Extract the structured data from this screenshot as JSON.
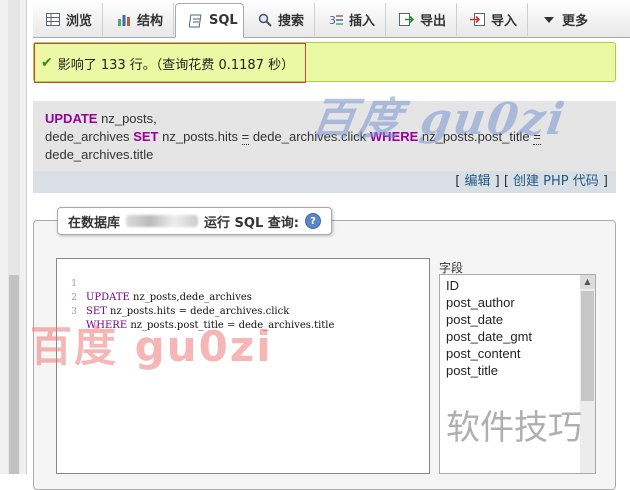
{
  "tabs": [
    {
      "label": "浏览",
      "icon": "browse-icon"
    },
    {
      "label": "结构",
      "icon": "structure-icon"
    },
    {
      "label": "SQL",
      "icon": "sql-icon"
    },
    {
      "label": "搜索",
      "icon": "search-icon"
    },
    {
      "label": "插入",
      "icon": "insert-icon"
    },
    {
      "label": "导出",
      "icon": "export-icon"
    },
    {
      "label": "导入",
      "icon": "import-icon"
    },
    {
      "label": "更多",
      "icon": "chevron-down-icon"
    }
  ],
  "message": {
    "text": "影响了 133 行。（查询花费 0.1187 秒）"
  },
  "sql_display": {
    "kw_update": "UPDATE",
    "t1": "nz_posts,",
    "t2": "dede_archives",
    "kw_set": "SET",
    "t3": "nz_posts.hits",
    "eq": "=",
    "t4": "dede_archives.click",
    "kw_where": "WHERE",
    "t5": "nz_posts.post_title",
    "t6": "dede_archives.title"
  },
  "sql_links": {
    "open": "[",
    "edit": "编辑",
    "mid": "] [",
    "create_php": "创建 PHP 代码",
    "close": "]"
  },
  "run_sql": {
    "legend_prefix": "在数据库",
    "legend_suffix": "运行 SQL 查询:"
  },
  "editor": {
    "lines": [
      {
        "num": "1",
        "kw": "UPDATE",
        "rest": " nz_posts,dede_archives"
      },
      {
        "num": "2",
        "kw": "SET",
        "rest": " nz_posts.hits = dede_archives.click"
      },
      {
        "num": "3",
        "kw": "WHERE",
        "rest": " nz_posts.post_title = dede_archives.title"
      }
    ]
  },
  "fields": {
    "label": "字段",
    "items": [
      "ID",
      "post_author",
      "post_date",
      "post_date_gmt",
      "post_content",
      "post_title"
    ]
  },
  "watermarks": {
    "top": "百度 gu0zi",
    "red": "百度  gu0zi",
    "gray": "软件技巧"
  },
  "colors": {
    "keyword": "#990099",
    "link": "#235a81",
    "success_bg": "#ebf8a4",
    "success_border": "#a2d246"
  }
}
